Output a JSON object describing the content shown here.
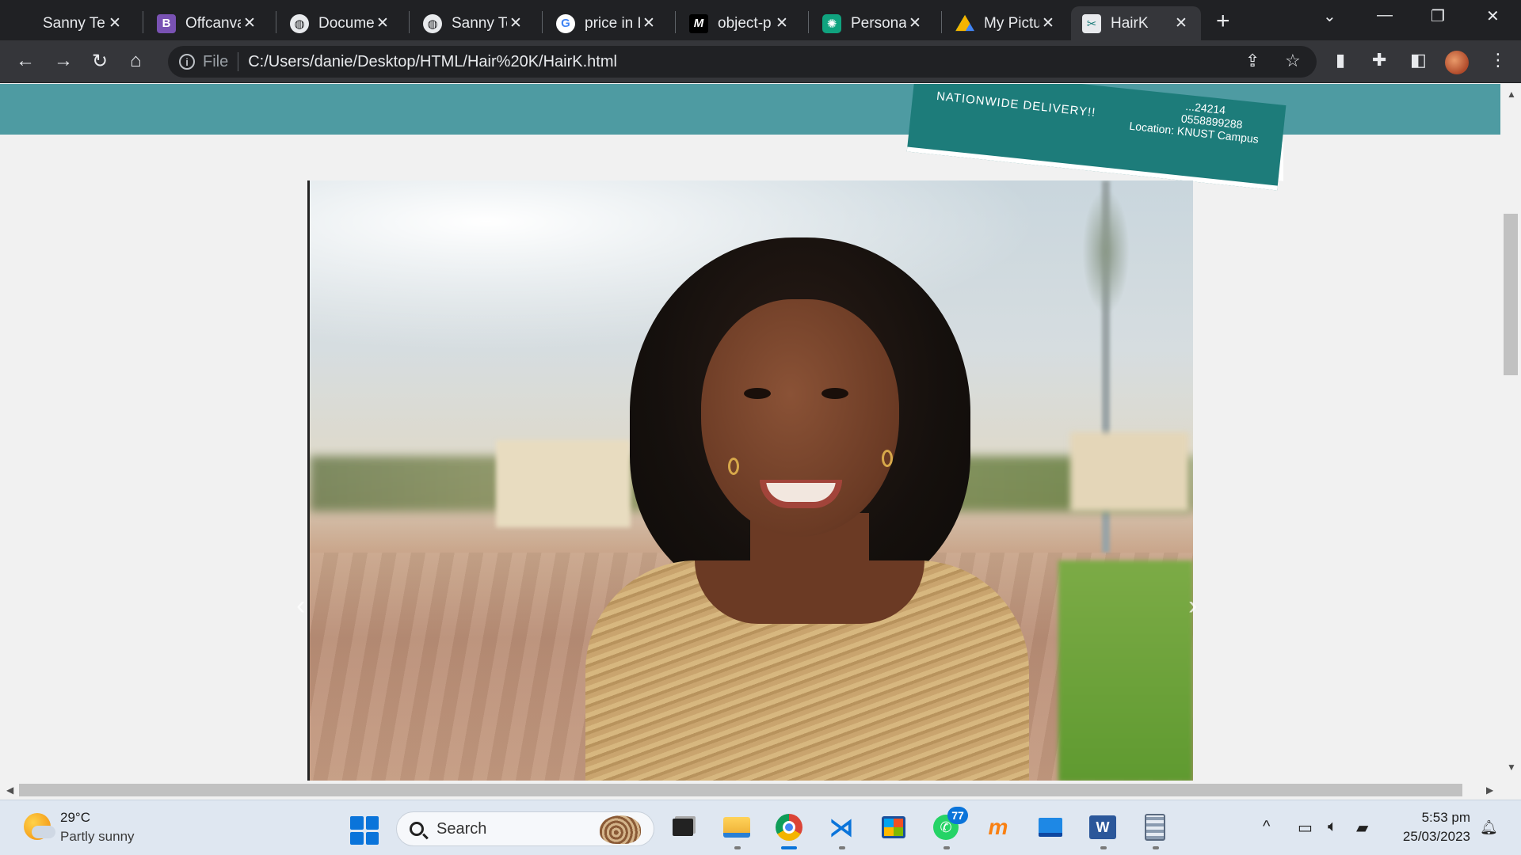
{
  "browser": {
    "tabs": [
      {
        "label": "Sanny Te",
        "favicon": "sanny-favicon",
        "active": false
      },
      {
        "label": "Offcanva",
        "favicon": "bootstrap-icon",
        "active": false
      },
      {
        "label": "Documer",
        "favicon": "globe-icon",
        "active": false
      },
      {
        "label": "Sanny Te",
        "favicon": "globe-icon",
        "active": false
      },
      {
        "label": "price in L",
        "favicon": "google-icon",
        "active": false
      },
      {
        "label": "object-p",
        "favicon": "mdn-icon",
        "active": false
      },
      {
        "label": "Personal",
        "favicon": "chatgpt-icon",
        "active": false
      },
      {
        "label": "My Pictu",
        "favicon": "google-drive-icon",
        "active": false
      },
      {
        "label": "HairK",
        "favicon": "hairk-favicon",
        "active": true
      }
    ],
    "close_glyph": "✕",
    "new_tab_glyph": "+",
    "url_scheme": "File",
    "url": "C:/Users/danie/Desktop/HTML/Hair%20K/HairK.html",
    "colors": {
      "frame": "#202124",
      "toolbar": "#35363a",
      "accent": "#0a74da"
    }
  },
  "page": {
    "promo": {
      "delivery": "NATIONWIDE DELIVERY!!",
      "phone_partial": "...24214",
      "phone": "0558899288",
      "location": "Location: KNUST Campus"
    },
    "carousel": {
      "prev_glyph": "‹",
      "next_glyph": "›"
    },
    "colors": {
      "header_band": "#4e9ba2",
      "promo_card": "#1d7c7a",
      "background": "#f1f1f1"
    }
  },
  "taskbar": {
    "weather": {
      "temp": "29°C",
      "condition": "Partly sunny"
    },
    "search_placeholder": "Search",
    "pinned_apps": [
      "task-view",
      "file-explorer",
      "chrome",
      "vscode",
      "microsoft-store",
      "whatsapp",
      "moodle",
      "remote-desktop",
      "word",
      "calculator"
    ],
    "whatsapp_badge": "77",
    "clock": {
      "time": "5:53 pm",
      "date": "25/03/2023"
    }
  }
}
